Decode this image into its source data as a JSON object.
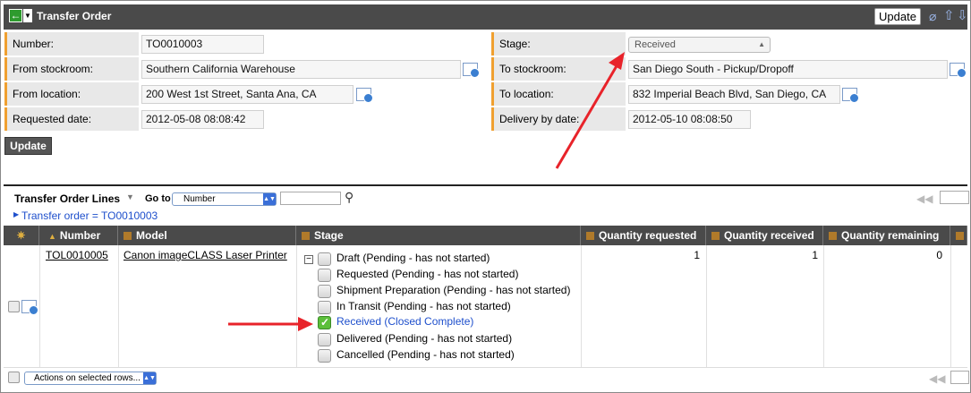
{
  "header": {
    "title": "Transfer Order",
    "update_label": "Update",
    "icons": [
      "back-icon",
      "menu-icon",
      "paperclip-icon",
      "up-arrow-icon",
      "down-arrow-icon"
    ]
  },
  "form": {
    "number_label": "Number:",
    "number_value": "TO0010003",
    "from_stockroom_label": "From stockroom:",
    "from_stockroom_value": "Southern California Warehouse",
    "from_location_label": "From location:",
    "from_location_value": "200 West 1st Street, Santa Ana, CA",
    "requested_date_label": "Requested date:",
    "requested_date_value": "2012-05-08 08:08:42",
    "stage_label": "Stage:",
    "stage_value": "Received",
    "to_stockroom_label": "To stockroom:",
    "to_stockroom_value": "San Diego South - Pickup/Dropoff",
    "to_location_label": "To location:",
    "to_location_value": "832 Imperial Beach Blvd, San Diego, CA",
    "delivery_date_label": "Delivery by date:",
    "delivery_date_value": "2012-05-10 08:08:50",
    "update_label": "Update"
  },
  "related_list": {
    "title": "Transfer Order Lines",
    "goto_label": "Go to",
    "goto_selected": "Number",
    "breadcrumb": "Transfer order = TO0010003",
    "columns": {
      "number": "Number",
      "model": "Model",
      "stage": "Stage",
      "qty_requested": "Quantity requested",
      "qty_received": "Quantity received",
      "qty_remaining": "Quantity remaining"
    },
    "row": {
      "number": "TOL0010005",
      "model": "Canon imageCLASS Laser Printer",
      "qty_requested": "1",
      "qty_received": "1",
      "qty_remaining": "0",
      "stages": [
        {
          "label": "Draft (Pending - has not started)",
          "checked": false
        },
        {
          "label": "Requested (Pending - has not started)",
          "checked": false
        },
        {
          "label": "Shipment Preparation (Pending - has not started)",
          "checked": false
        },
        {
          "label": "In Transit (Pending - has not started)",
          "checked": false
        },
        {
          "label": "Received (Closed Complete)",
          "checked": true
        },
        {
          "label": "Delivered (Pending - has not started)",
          "checked": false
        },
        {
          "label": "Cancelled (Pending - has not started)",
          "checked": false
        }
      ]
    },
    "actions_label": "Actions on selected rows...",
    "pager_glyph": "◀◀"
  },
  "colors": {
    "header_bg": "#4a4a4a",
    "label_accent": "#f0a030",
    "annotation_arrow": "#e8232a",
    "link_blue": "#1e4fcc"
  }
}
